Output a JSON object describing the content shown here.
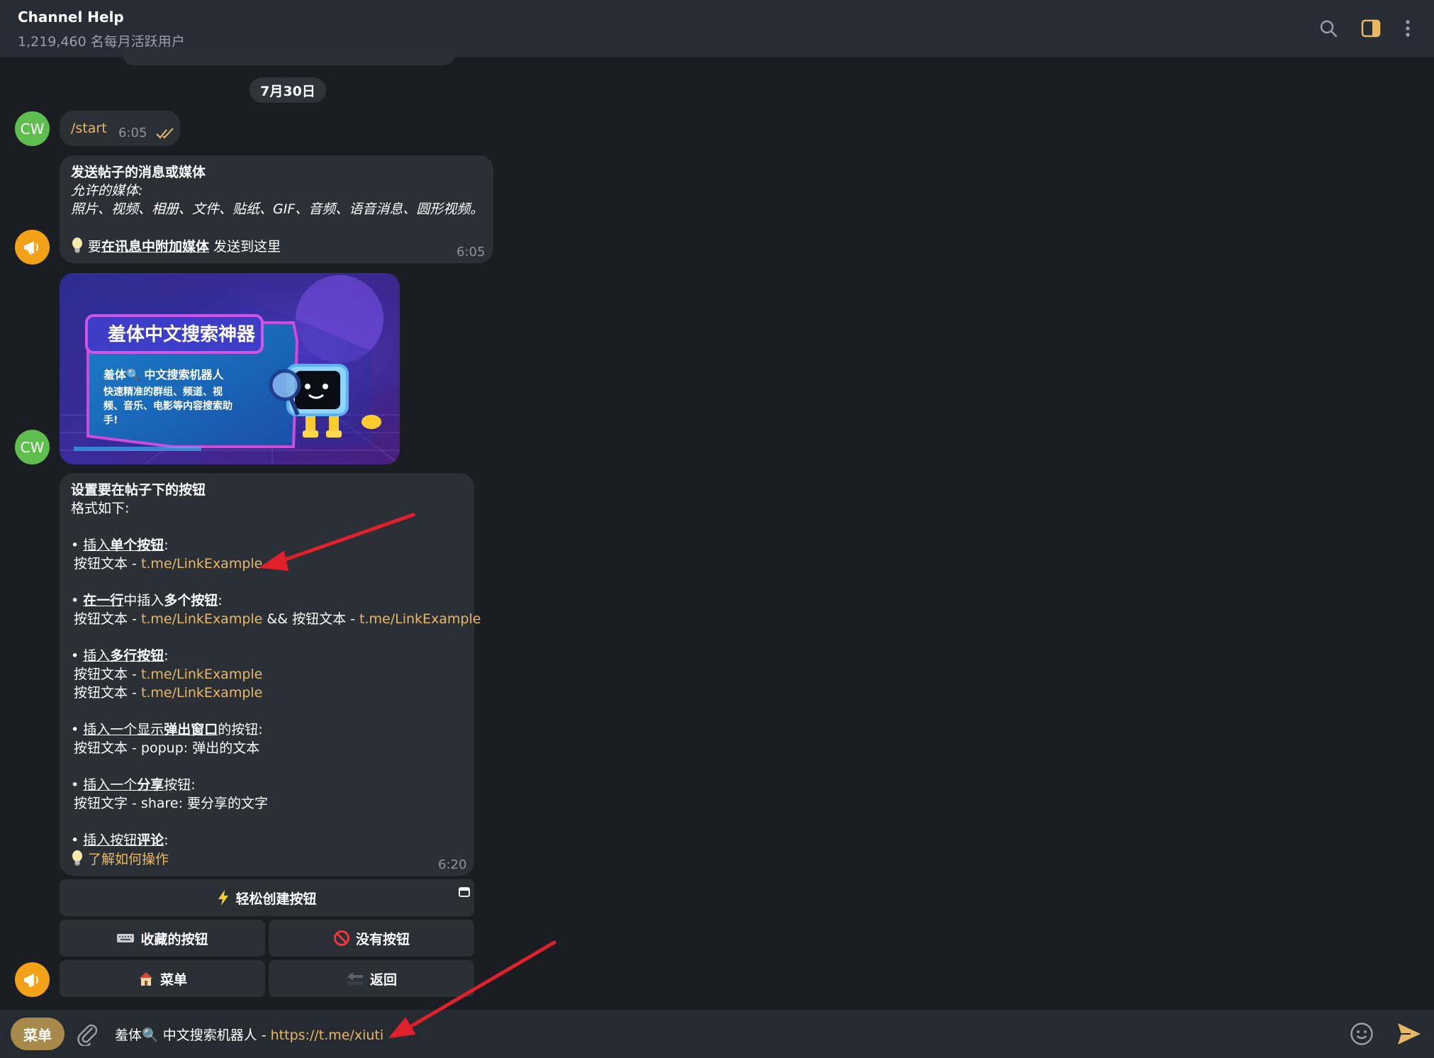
{
  "header": {
    "title": "Channel Help",
    "subtitle": "1,219,460 名每月活跃用户"
  },
  "date_chip": "7月30日",
  "messages": {
    "start": {
      "avatar": "CW",
      "text": "/start",
      "time": "6:05"
    },
    "post_prompt": {
      "title": "发送帖子的消息或媒体",
      "allowed_label": "允许的媒体:",
      "allowed_list": "照片、视频、相册、文件、贴纸、GIF、音频、语音消息、圆形视频。",
      "tip_prefix": "要",
      "tip_link": "在讯息中附加媒体",
      "tip_suffix": " 发送到这里",
      "time": "6:05"
    },
    "image": {
      "avatar": "CW",
      "banner_title": "羞体中文搜索神器",
      "banner_sub": "羞体🔍 中文搜索机器人",
      "banner_desc_1": "快速精准的群组、频道、视",
      "banner_desc_2": "频、音乐、电影等内容搜索助",
      "banner_desc_3": "手!"
    },
    "buttons_help": {
      "title": "设置要在帖子下的按钮",
      "format": "格式如下:",
      "s1_bullet": "• ",
      "s1_a": "插入",
      "s1_b": "单个按钮",
      "s1_c": ":",
      "s1_l1_text": "按钮文本 - ",
      "s1_l1_link": "t.me/LinkExample",
      "s2_a": "在一行",
      "s2_b": "中插入",
      "s2_c": "多个按钮",
      "s2_d": ":",
      "s2_l1_text": "按钮文本 - ",
      "s2_l1_link": "t.me/LinkExample",
      "s2_l1_mid": " && 按钮文本 - ",
      "s2_l1_link2": "t.me/LinkExample",
      "s3_a": "插入",
      "s3_b": "多行按钮",
      "s3_c": ":",
      "s3_l1_text": "按钮文本 - ",
      "s3_l1_link": "t.me/LinkExample",
      "s3_l2_text": "按钮文本 - ",
      "s3_l2_link": "t.me/LinkExample",
      "s4_a": "插入一个显示",
      "s4_b": "弹出窗口",
      "s4_c": "的按钮:",
      "s4_l1": "按钮文本 - popup: 弹出的文本",
      "s5_a": "插入一个",
      "s5_b": "分享",
      "s5_c": "按钮:",
      "s5_l1": "按钮文字 - share: 要分享的文字",
      "s6_a": "插入按钮",
      "s6_b": "评论",
      "s6_c": ":",
      "learn_link": "了解如何操作",
      "time": "6:20"
    }
  },
  "keyboard": {
    "easy_create": "轻松创建按钮",
    "saved_buttons": "收藏的按钮",
    "no_buttons": "没有按钮",
    "menu": "菜单",
    "back": "返回"
  },
  "composer": {
    "menu_label": "菜单",
    "input_prefix": "羞体🔍 中文搜索机器人 - ",
    "input_link": "https://t.me/xiuti"
  },
  "colors": {
    "background": "#1a1d22",
    "bubble": "#2b2f36",
    "link": "#e9b866",
    "arrow": "#e0202a"
  }
}
